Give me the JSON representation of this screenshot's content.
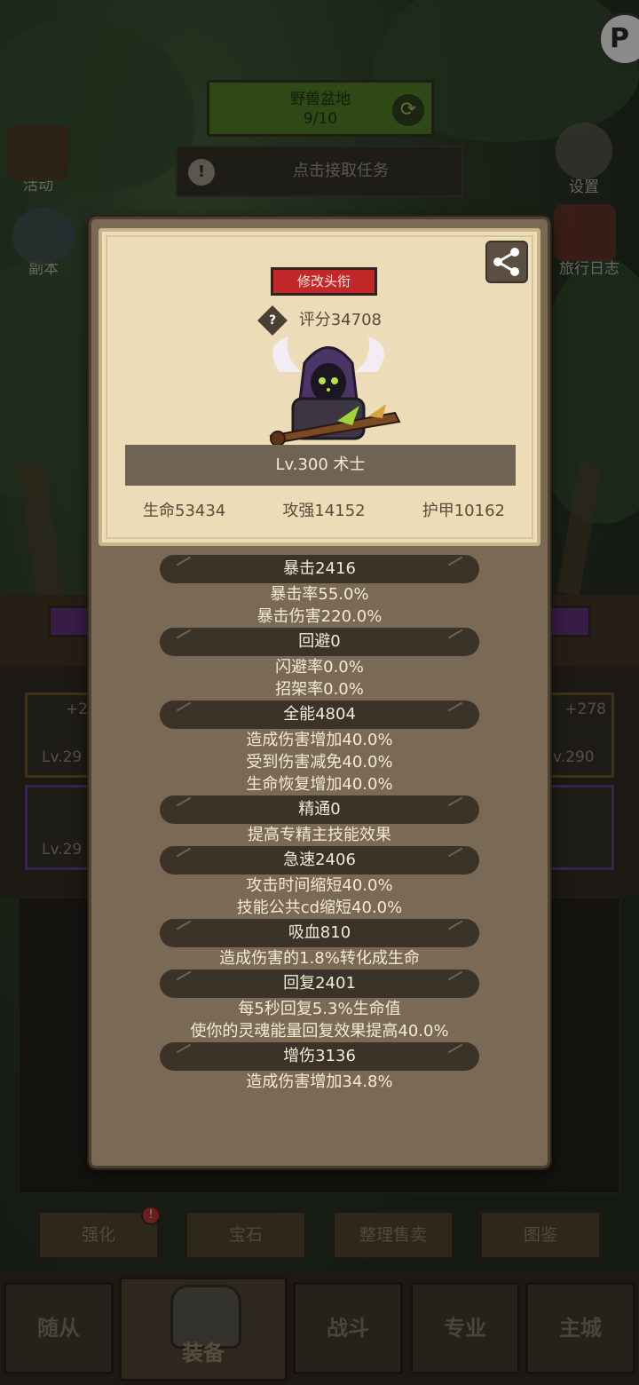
{
  "background": {
    "zone_name": "野兽盆地",
    "zone_progress": "9/10",
    "quest_label": "点击接取任务",
    "side_buttons": {
      "activity": "活动",
      "dungeon": "副本",
      "settings": "设置",
      "travel_log": "旅行日志"
    },
    "slot_levels": [
      "Lv.29",
      "Lv.29",
      "v.290"
    ],
    "slot_bonus_left": "+2",
    "slot_bonus_right": "+278",
    "bottom_tabs": [
      "强化",
      "宝石",
      "整理售卖",
      "图鉴"
    ],
    "notification_mark": "!",
    "nav": [
      "随从",
      "装备",
      "战斗",
      "专业",
      "主城"
    ]
  },
  "card": {
    "change_title_button": "修改头衔",
    "score_help": "?",
    "score": "评分34708",
    "level_class": "Lv.300 术士",
    "hp": "生命53434",
    "attack": "攻强14152",
    "armor": "护甲10162"
  },
  "attributes": [
    {
      "head": "暴击2416",
      "lines": [
        "暴击率55.0%",
        "暴击伤害220.0%"
      ]
    },
    {
      "head": "回避0",
      "lines": [
        "闪避率0.0%",
        "招架率0.0%"
      ]
    },
    {
      "head": "全能4804",
      "lines": [
        "造成伤害增加40.0%",
        "受到伤害减免40.0%",
        "生命恢复增加40.0%"
      ]
    },
    {
      "head": "精通0",
      "lines": [
        "提高专精主技能效果"
      ]
    },
    {
      "head": "急速2406",
      "lines": [
        "攻击时间缩短40.0%",
        "技能公共cd缩短40.0%"
      ]
    },
    {
      "head": "吸血810",
      "lines": [
        "造成伤害的1.8%转化成生命"
      ]
    },
    {
      "head": "回复2401",
      "lines": [
        "每5秒回复5.3%生命值",
        "使你的灵魂能量回复效果提高40.0%"
      ]
    },
    {
      "head": "增伤3136",
      "lines": [
        "造成伤害增加34.8%"
      ]
    }
  ]
}
